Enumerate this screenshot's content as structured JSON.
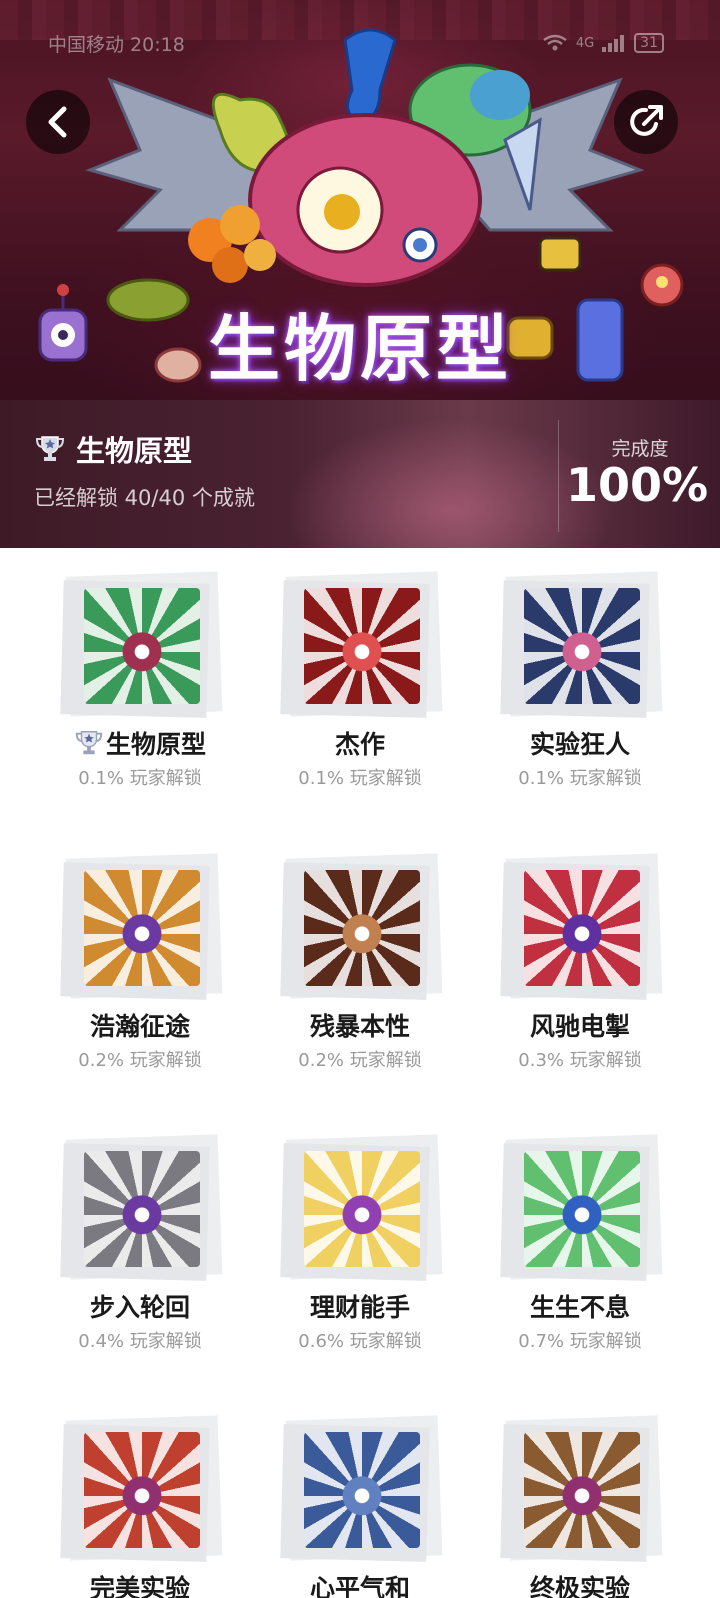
{
  "status_bar": {
    "carrier_time": "中国移动 20:18",
    "network": "4G",
    "battery": "31"
  },
  "hero": {
    "banner_title": "生物原型"
  },
  "info": {
    "name": "生物原型",
    "unlocked_text": "已经解锁 40/40 个成就",
    "completion_label": "完成度",
    "completion_value": "100%"
  },
  "achievements": [
    {
      "name": "生物原型",
      "percent": "0.1% 玩家解锁",
      "trophy": true,
      "icon": "eyeball-creature-icon",
      "colors": [
        "#3a9a5a",
        "#a03050"
      ]
    },
    {
      "name": "杰作",
      "percent": "0.1% 玩家解锁",
      "icon": "lv5-creatures-icon",
      "colors": [
        "#8a1a1a",
        "#e05050"
      ]
    },
    {
      "name": "实验狂人",
      "percent": "0.1% 玩家解锁",
      "icon": "many-creatures-icon",
      "colors": [
        "#2a3a6a",
        "#d06090"
      ]
    },
    {
      "name": "浩瀚征途",
      "percent": "0.2% 玩家解锁",
      "icon": "infinity-35-icon",
      "colors": [
        "#d08a30",
        "#6a3aa0"
      ]
    },
    {
      "name": "残暴本性",
      "percent": "0.2% 玩家解锁",
      "icon": "brown-burst-icon",
      "colors": [
        "#5a2a1a",
        "#c08050"
      ]
    },
    {
      "name": "风驰电掣",
      "percent": "0.3% 玩家解锁",
      "icon": "red-burst-icon",
      "colors": [
        "#c03040",
        "#6030a0"
      ]
    },
    {
      "name": "步入轮回",
      "percent": "0.4% 玩家解锁",
      "icon": "infinity-25-icon",
      "colors": [
        "#7a7a80",
        "#6a3aa0"
      ]
    },
    {
      "name": "理财能手",
      "percent": "0.6% 玩家解锁",
      "icon": "yellow-burst-icon",
      "colors": [
        "#f0d060",
        "#9040b0"
      ]
    },
    {
      "name": "生生不息",
      "percent": "0.7% 玩家解锁",
      "icon": "blue-burst-icon",
      "colors": [
        "#60c070",
        "#3060c0"
      ]
    },
    {
      "name": "完美实验",
      "percent": "",
      "icon": "lv5-vines-icon",
      "colors": [
        "#c04030",
        "#903070"
      ]
    },
    {
      "name": "心平气和",
      "percent": "",
      "icon": "gray-burst-icon",
      "colors": [
        "#3a5a9a",
        "#6080c0"
      ]
    },
    {
      "name": "终极实验",
      "percent": "",
      "icon": "lv4-vines-icon",
      "colors": [
        "#8a5a30",
        "#903070"
      ]
    }
  ]
}
